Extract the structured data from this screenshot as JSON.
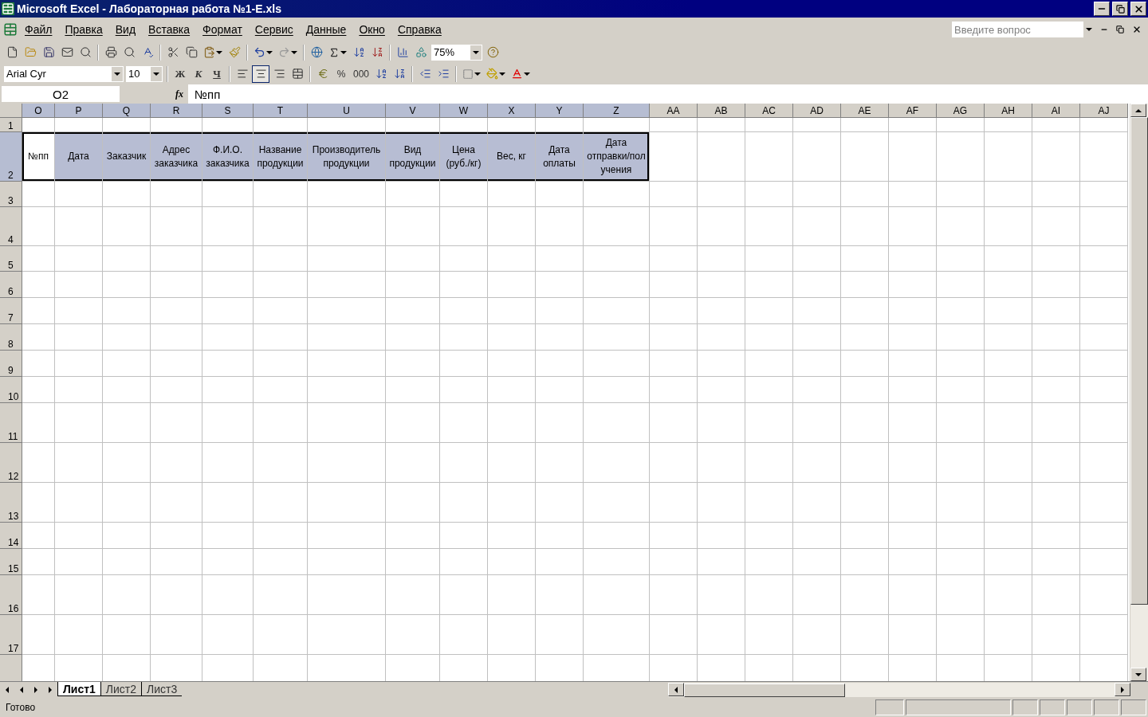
{
  "window": {
    "title": "Microsoft Excel - Лабораторная работа №1-E.xls"
  },
  "menu": [
    "Файл",
    "Правка",
    "Вид",
    "Вставка",
    "Формат",
    "Сервис",
    "Данные",
    "Окно",
    "Справка"
  ],
  "help_search": {
    "placeholder": "Введите вопрос"
  },
  "standard_toolbar": {
    "zoom": "75%"
  },
  "formatting_toolbar": {
    "font": "Arial Cyr",
    "size": "10",
    "style_buttons": [
      {
        "kind": "bold",
        "label": "Ж"
      },
      {
        "kind": "italic",
        "label": "К"
      },
      {
        "kind": "underline",
        "label": "Ч"
      }
    ],
    "align_buttons": [
      {
        "kind": "left",
        "selected": false
      },
      {
        "kind": "center",
        "selected": true
      },
      {
        "kind": "right",
        "selected": false
      }
    ],
    "percent": "%",
    "thousands": "000"
  },
  "formula_bar": {
    "name_box": "O2",
    "fx_label": "fx",
    "formula": "№пп"
  },
  "sheet": {
    "columns": [
      {
        "label": "O",
        "selected": true
      },
      {
        "label": "P",
        "selected": true
      },
      {
        "label": "Q",
        "selected": true
      },
      {
        "label": "R",
        "selected": true
      },
      {
        "label": "S",
        "selected": true
      },
      {
        "label": "T",
        "selected": true
      },
      {
        "label": "U",
        "selected": true
      },
      {
        "label": "V",
        "selected": true
      },
      {
        "label": "W",
        "selected": true
      },
      {
        "label": "X",
        "selected": true
      },
      {
        "label": "Y",
        "selected": true
      },
      {
        "label": "Z",
        "selected": true
      },
      {
        "label": "AA",
        "selected": false
      },
      {
        "label": "AB",
        "selected": false
      },
      {
        "label": "AC",
        "selected": false
      },
      {
        "label": "AD",
        "selected": false
      },
      {
        "label": "AE",
        "selected": false
      },
      {
        "label": "AF",
        "selected": false
      },
      {
        "label": "AG",
        "selected": false
      },
      {
        "label": "AH",
        "selected": false
      },
      {
        "label": "AI",
        "selected": false
      },
      {
        "label": "AJ",
        "selected": false
      }
    ],
    "rows": [
      {
        "label": "1",
        "selected": false
      },
      {
        "label": "2",
        "selected": true,
        "cells": [
          {
            "text": "№пп",
            "active": true
          },
          {
            "text": "Дата",
            "active": false
          },
          {
            "text": "Заказчик",
            "active": false
          },
          {
            "text": "Адрес\nзаказчика",
            "active": false
          },
          {
            "text": "Ф.И.О.\nзаказчика",
            "active": false
          },
          {
            "text": "Название\nпродукции",
            "active": false
          },
          {
            "text": "Производитель\nпродукции",
            "active": false
          },
          {
            "text": "Вид\nпродукции",
            "active": false
          },
          {
            "text": "Цена\n(руб./кг)",
            "active": false
          },
          {
            "text": "Вес, кг",
            "active": false
          },
          {
            "text": "Дата\nоплаты",
            "active": false
          },
          {
            "text": "Дата\nотправки/пол\nучения",
            "active": false
          }
        ]
      },
      {
        "label": "3",
        "selected": false
      },
      {
        "label": "4",
        "selected": false
      },
      {
        "label": "5",
        "selected": false
      },
      {
        "label": "6",
        "selected": false
      },
      {
        "label": "7",
        "selected": false
      },
      {
        "label": "8",
        "selected": false
      },
      {
        "label": "9",
        "selected": false
      },
      {
        "label": "10",
        "selected": false
      },
      {
        "label": "11",
        "selected": false
      },
      {
        "label": "12",
        "selected": false
      },
      {
        "label": "13",
        "selected": false
      },
      {
        "label": "14",
        "selected": false
      },
      {
        "label": "15",
        "selected": false
      },
      {
        "label": "16",
        "selected": false
      },
      {
        "label": "17",
        "selected": false
      }
    ]
  },
  "sheet_tabs": [
    {
      "label": "Лист1",
      "selected": true
    },
    {
      "label": "Лист2",
      "selected": false
    },
    {
      "label": "Лист3",
      "selected": false
    }
  ],
  "status_bar": {
    "text": "Готово"
  }
}
